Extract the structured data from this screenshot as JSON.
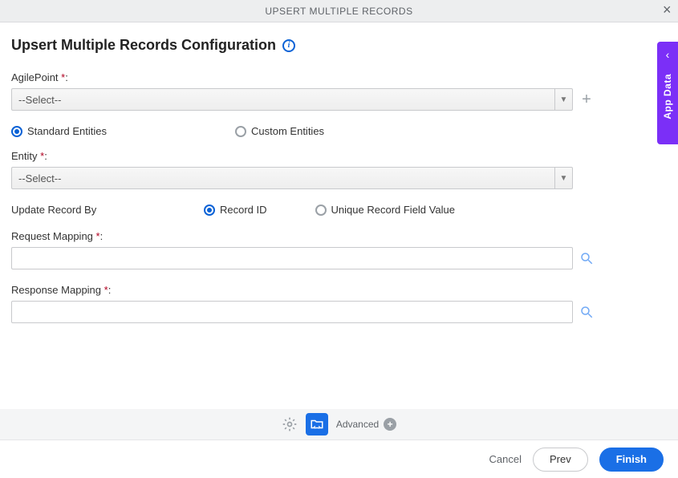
{
  "header": {
    "title": "UPSERT MULTIPLE RECORDS"
  },
  "page": {
    "title": "Upsert Multiple Records Configuration"
  },
  "sideTab": {
    "label": "App Data"
  },
  "fields": {
    "agilepoint": {
      "label": "AgilePoint ",
      "req": "*",
      "colon": ":",
      "selected": "--Select--"
    },
    "entityType": {
      "options": [
        {
          "label": "Standard Entities",
          "selected": true
        },
        {
          "label": "Custom Entities",
          "selected": false
        }
      ]
    },
    "entity": {
      "label": "Entity ",
      "req": "*",
      "colon": ":",
      "selected": "--Select--"
    },
    "updateBy": {
      "label": "Update Record By",
      "options": [
        {
          "label": "Record ID",
          "selected": true
        },
        {
          "label": "Unique Record Field Value",
          "selected": false
        }
      ]
    },
    "requestMapping": {
      "label": "Request Mapping ",
      "req": "*",
      "colon": ":",
      "value": ""
    },
    "responseMapping": {
      "label": "Response Mapping ",
      "req": "*",
      "colon": ":",
      "value": ""
    }
  },
  "toolbar": {
    "advanced": "Advanced"
  },
  "footer": {
    "cancel": "Cancel",
    "prev": "Prev",
    "finish": "Finish"
  }
}
